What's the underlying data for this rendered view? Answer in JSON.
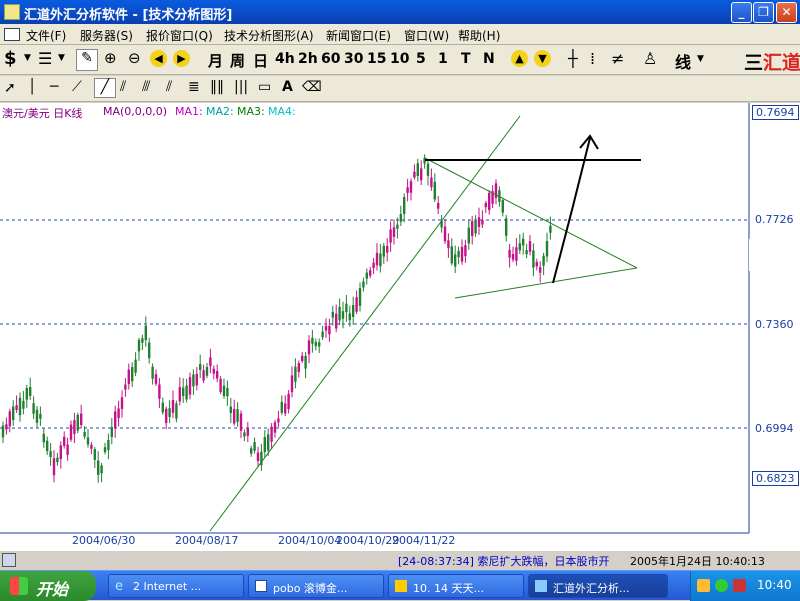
{
  "window": {
    "title": "汇道外汇分析软件 - [技术分析图形]"
  },
  "menu": [
    "文件(F)",
    "服务器(S)",
    "报价窗口(Q)",
    "技术分析图形(A)",
    "新闻窗口(E)",
    "窗口(W)",
    "帮助(H)"
  ],
  "toolbar": {
    "period_buttons": [
      "月",
      "周",
      "日",
      "4h",
      "2h",
      "60",
      "30",
      "15",
      "10",
      "5",
      "1",
      "T",
      "N"
    ],
    "line_label": "线",
    "logo": "汇道"
  },
  "chart": {
    "symbol_label": "澳元/美元 日K线",
    "ma_label": "MA(0,0,0,0)",
    "ma_items": [
      {
        "label": "MA1:",
        "color": "#c000c0"
      },
      {
        "label": "MA2:",
        "color": "#00a0a0"
      },
      {
        "label": "MA3:",
        "color": "#008000"
      },
      {
        "label": "MA4:",
        "color": "#00c0c0"
      }
    ],
    "price_labels": [
      "0.7694",
      "0.7726",
      "0.7360",
      "0.6994",
      "0.6823"
    ],
    "date_labels": [
      "2004/06/30",
      "2004/08/17",
      "2004/10/04",
      "2004/10/29",
      "2004/11/22"
    ]
  },
  "chart_data": {
    "type": "candlestick",
    "y_ticks": [
      0.7726,
      0.736,
      0.6994
    ],
    "y_top": 0.7694,
    "y_bottom": 0.6823,
    "x_ticks": [
      "2004/06/30",
      "2004/08/17",
      "2004/10/04",
      "2004/10/29",
      "2004/11/22"
    ],
    "colors": {
      "up": "#c8108a",
      "down": "#208030",
      "trendline": "#208020"
    }
  },
  "status": {
    "news": "[24-08:37:34] 索尼扩大跌幅，日本股市开",
    "datetime": "2005年1月24日  10:40:13"
  },
  "taskbar": {
    "start": "开始",
    "tasks": [
      "2 Internet ...",
      "pobo 滚博金...",
      "10. 14 天天...",
      "汇道外汇分析..."
    ],
    "clock": "10:40"
  }
}
